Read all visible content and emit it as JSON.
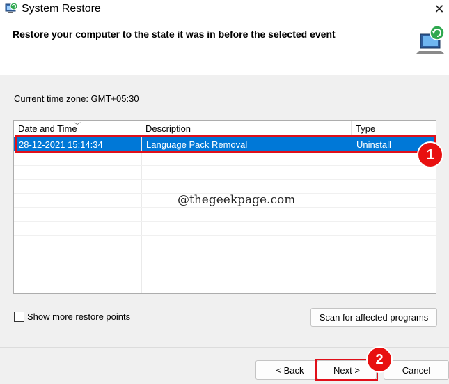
{
  "window": {
    "title": "System Restore",
    "close_label": "✕"
  },
  "header": {
    "heading": "Restore your computer to the state it was in before the selected event"
  },
  "timezone": "Current time zone: GMT+05:30",
  "table": {
    "columns": [
      "Date and Time",
      "Description",
      "Type"
    ],
    "rows": [
      {
        "date": "28-12-2021 15:14:34",
        "description": "Language Pack Removal",
        "type": "Uninstall"
      }
    ]
  },
  "watermark": "@thegeekpage.com",
  "annotations": {
    "step1": "1",
    "step2": "2",
    "color": "#e0101a"
  },
  "options": {
    "show_more_label": "Show more restore points",
    "show_more_checked": false
  },
  "buttons": {
    "scan": "Scan for affected programs",
    "back": "< Back",
    "next": "Next >",
    "cancel": "Cancel"
  },
  "colors": {
    "selection": "#0078d7",
    "header_bg": "#ffffff",
    "window_bg": "#f0f0f0"
  }
}
